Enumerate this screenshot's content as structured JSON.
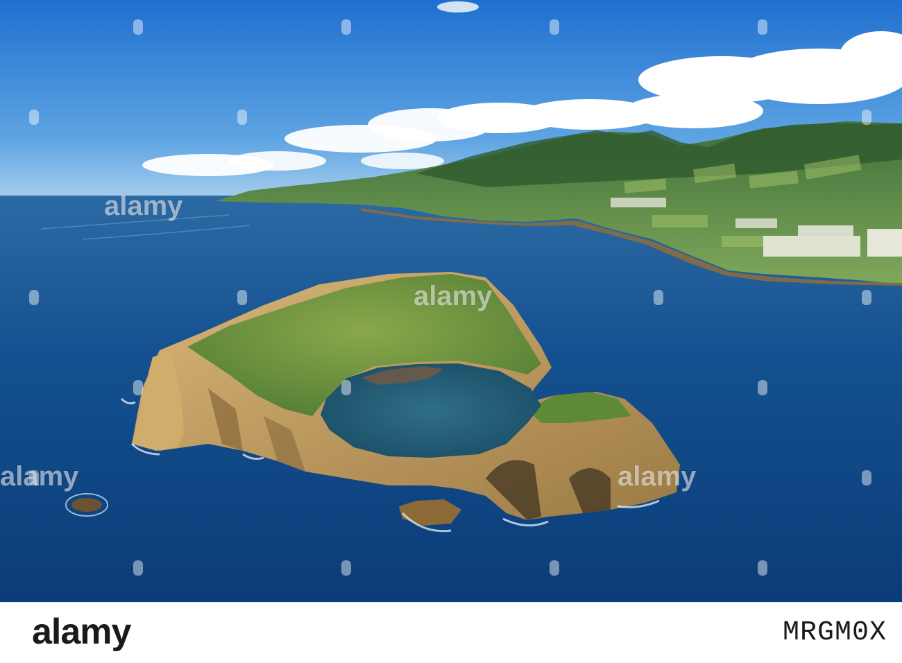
{
  "watermark": {
    "brand": "alamy",
    "image_id": "MRGM0X"
  },
  "scene": {
    "sky_color": "#2e7fd4",
    "ocean_color": "#0f4a86",
    "cliff_color": "#c7a463",
    "vegetation_color": "#5f8f3a"
  }
}
